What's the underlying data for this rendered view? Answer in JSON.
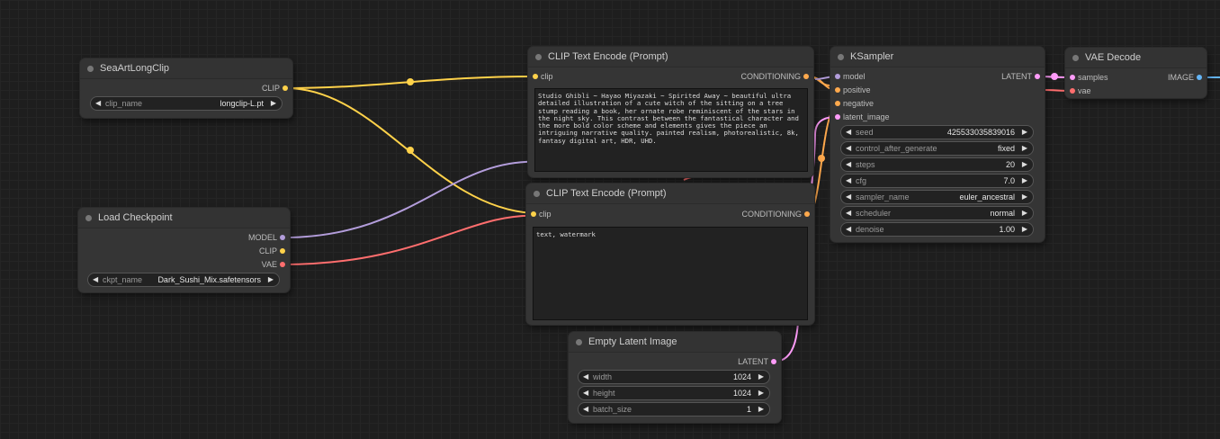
{
  "nodes": {
    "longclip": {
      "title": "SeaArtLongClip",
      "output_clip": "CLIP",
      "widget_label": "clip_name",
      "widget_value": "longclip-L.pt"
    },
    "checkpoint": {
      "title": "Load Checkpoint",
      "outputs": {
        "model": "MODEL",
        "clip": "CLIP",
        "vae": "VAE"
      },
      "widget_label": "ckpt_name",
      "widget_value": "Dark_Sushi_Mix.safetensors"
    },
    "clip_pos": {
      "title": "CLIP Text Encode (Prompt)",
      "input_clip": "clip",
      "output": "CONDITIONING",
      "text": "Studio Ghibli ~ Hayao Miyazaki ~ Spirited Away ~ beautiful ultra detailed illustration of a cute witch of the sitting on a tree stump reading a book, her ornate robe reminiscent of the stars in the night sky. This contrast between the fantastical character and the more bold color scheme and elements gives the piece an intriguing narrative quality. painted realism, photorealistic, 8k, fantasy digital art, HDR, UHD."
    },
    "clip_neg": {
      "title": "CLIP Text Encode (Prompt)",
      "input_clip": "clip",
      "output": "CONDITIONING",
      "text": "text, watermark"
    },
    "ksampler": {
      "title": "KSampler",
      "inputs": {
        "model": "model",
        "positive": "positive",
        "negative": "negative",
        "latent_image": "latent_image"
      },
      "output": "LATENT",
      "widgets": [
        {
          "label": "seed",
          "value": "425533035839016"
        },
        {
          "label": "control_after_generate",
          "value": "fixed"
        },
        {
          "label": "steps",
          "value": "20"
        },
        {
          "label": "cfg",
          "value": "7.0"
        },
        {
          "label": "sampler_name",
          "value": "euler_ancestral"
        },
        {
          "label": "scheduler",
          "value": "normal"
        },
        {
          "label": "denoise",
          "value": "1.00"
        }
      ]
    },
    "latent": {
      "title": "Empty Latent Image",
      "output": "LATENT",
      "widgets": [
        {
          "label": "width",
          "value": "1024"
        },
        {
          "label": "height",
          "value": "1024"
        },
        {
          "label": "batch_size",
          "value": "1"
        }
      ]
    },
    "vae_decode": {
      "title": "VAE Decode",
      "inputs": {
        "samples": "samples",
        "vae": "vae"
      },
      "output": "IMAGE"
    }
  },
  "colors": {
    "clip": "#ffd24a",
    "model": "#b39ddb",
    "vae": "#ff6e6e",
    "conditioning": "#ffa94d",
    "latent": "#ff9cf9",
    "image": "#64b5f6"
  }
}
